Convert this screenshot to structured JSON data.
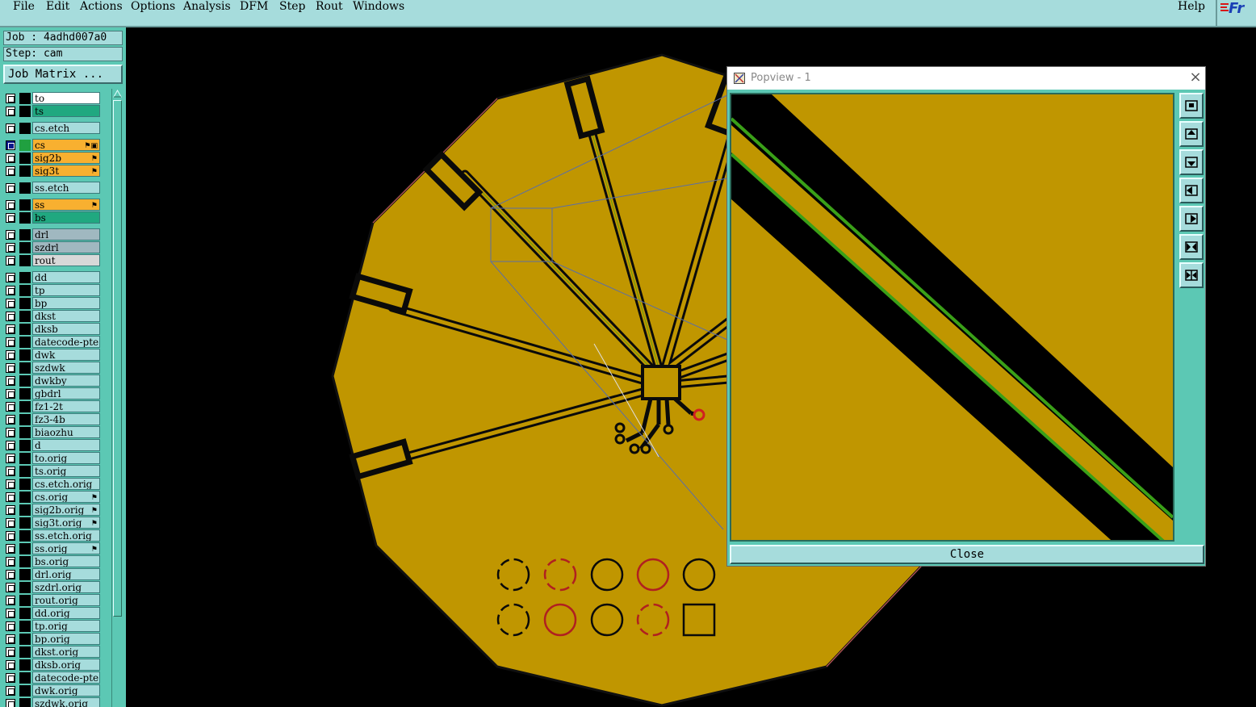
{
  "menu": {
    "items": [
      {
        "label": "File",
        "key": "file"
      },
      {
        "label": "Edit",
        "key": "edit"
      },
      {
        "label": "Actions",
        "key": "actions"
      },
      {
        "label": "Options",
        "key": "options"
      },
      {
        "label": "Analysis",
        "key": "analysis"
      },
      {
        "label": "DFM",
        "key": "dfm"
      },
      {
        "label": "Step",
        "key": "step"
      },
      {
        "label": "Rout",
        "key": "rout"
      },
      {
        "label": "Windows",
        "key": "windows"
      }
    ],
    "help": "Help",
    "logo": "Fr"
  },
  "job": {
    "job_text": "Job : 4adhd007a0",
    "step_text": "Step: cam",
    "matrix_button": "Job Matrix ..."
  },
  "layers": [
    {
      "name": "to",
      "color": "#ffffff",
      "box": "#000000",
      "flag": ""
    },
    {
      "name": "ts",
      "color": "#20a880",
      "box": "#000000",
      "flag": ""
    },
    {
      "name": "cs.etch",
      "color": "#a6dcdc",
      "box": "#000000",
      "flag": ""
    },
    {
      "name": "cs",
      "color": "#f8b030",
      "box": "#20a040",
      "flag": "⚑▣",
      "selected": true
    },
    {
      "name": "sig2b",
      "color": "#f8b030",
      "box": "#000000",
      "flag": "⚑"
    },
    {
      "name": "sig3t",
      "color": "#f8b030",
      "box": "#000000",
      "flag": "⚑"
    },
    {
      "name": "ss.etch",
      "color": "#a6dcdc",
      "box": "#000000",
      "flag": ""
    },
    {
      "name": "ss",
      "color": "#f8b030",
      "box": "#000000",
      "flag": "⚑"
    },
    {
      "name": "bs",
      "color": "#20a880",
      "box": "#000000",
      "flag": ""
    },
    {
      "name": "drl",
      "color": "#a0b8c0",
      "box": "#000000",
      "flag": ""
    },
    {
      "name": "szdrl",
      "color": "#a0b8c0",
      "box": "#000000",
      "flag": ""
    },
    {
      "name": "rout",
      "color": "#d8d8d8",
      "box": "#000000",
      "flag": ""
    },
    {
      "name": "dd",
      "color": "#a6dcdc",
      "box": "#000000",
      "flag": ""
    },
    {
      "name": "tp",
      "color": "#a6dcdc",
      "box": "#000000",
      "flag": ""
    },
    {
      "name": "bp",
      "color": "#a6dcdc",
      "box": "#000000",
      "flag": ""
    },
    {
      "name": "dkst",
      "color": "#a6dcdc",
      "box": "#000000",
      "flag": ""
    },
    {
      "name": "dksb",
      "color": "#a6dcdc",
      "box": "#000000",
      "flag": ""
    },
    {
      "name": "datecode-pte",
      "color": "#a6dcdc",
      "box": "#000000",
      "flag": ""
    },
    {
      "name": "dwk",
      "color": "#a6dcdc",
      "box": "#000000",
      "flag": ""
    },
    {
      "name": "szdwk",
      "color": "#a6dcdc",
      "box": "#000000",
      "flag": ""
    },
    {
      "name": "dwkby",
      "color": "#a6dcdc",
      "box": "#000000",
      "flag": ""
    },
    {
      "name": "gbdrl",
      "color": "#a6dcdc",
      "box": "#000000",
      "flag": ""
    },
    {
      "name": "fz1-2t",
      "color": "#a6dcdc",
      "box": "#000000",
      "flag": ""
    },
    {
      "name": "fz3-4b",
      "color": "#a6dcdc",
      "box": "#000000",
      "flag": ""
    },
    {
      "name": "biaozhu",
      "color": "#a6dcdc",
      "box": "#000000",
      "flag": ""
    },
    {
      "name": "d",
      "color": "#a6dcdc",
      "box": "#000000",
      "flag": ""
    },
    {
      "name": "to.orig",
      "color": "#a6dcdc",
      "box": "#000000",
      "flag": ""
    },
    {
      "name": "ts.orig",
      "color": "#a6dcdc",
      "box": "#000000",
      "flag": ""
    },
    {
      "name": "cs.etch.orig",
      "color": "#a6dcdc",
      "box": "#000000",
      "flag": ""
    },
    {
      "name": "cs.orig",
      "color": "#a6dcdc",
      "box": "#000000",
      "flag": "⚑"
    },
    {
      "name": "sig2b.orig",
      "color": "#a6dcdc",
      "box": "#000000",
      "flag": "⚑"
    },
    {
      "name": "sig3t.orig",
      "color": "#a6dcdc",
      "box": "#000000",
      "flag": "⚑"
    },
    {
      "name": "ss.etch.orig",
      "color": "#a6dcdc",
      "box": "#000000",
      "flag": ""
    },
    {
      "name": "ss.orig",
      "color": "#a6dcdc",
      "box": "#000000",
      "flag": "⚑"
    },
    {
      "name": "bs.orig",
      "color": "#a6dcdc",
      "box": "#000000",
      "flag": ""
    },
    {
      "name": "drl.orig",
      "color": "#a6dcdc",
      "box": "#000000",
      "flag": ""
    },
    {
      "name": "szdrl.orig",
      "color": "#a6dcdc",
      "box": "#000000",
      "flag": ""
    },
    {
      "name": "rout.orig",
      "color": "#a6dcdc",
      "box": "#000000",
      "flag": ""
    },
    {
      "name": "dd.orig",
      "color": "#a6dcdc",
      "box": "#000000",
      "flag": ""
    },
    {
      "name": "tp.orig",
      "color": "#a6dcdc",
      "box": "#000000",
      "flag": ""
    },
    {
      "name": "bp.orig",
      "color": "#a6dcdc",
      "box": "#000000",
      "flag": ""
    },
    {
      "name": "dkst.orig",
      "color": "#a6dcdc",
      "box": "#000000",
      "flag": ""
    },
    {
      "name": "dksb.orig",
      "color": "#a6dcdc",
      "box": "#000000",
      "flag": ""
    },
    {
      "name": "datecode-pte",
      "color": "#a6dcdc",
      "box": "#000000",
      "flag": ""
    },
    {
      "name": "dwk.orig",
      "color": "#a6dcdc",
      "box": "#000000",
      "flag": ""
    },
    {
      "name": "szdwk.orig",
      "color": "#a6dcdc",
      "box": "#000000",
      "flag": ""
    }
  ],
  "popview": {
    "title": "Popview - 1",
    "close_label": "Close",
    "close_x": "×",
    "toolbar_icons": [
      "zoom-window-icon",
      "pan-up-icon",
      "pan-down-icon",
      "pan-left-icon",
      "pan-right-icon",
      "zoom-out-icon",
      "zoom-in-icon"
    ]
  },
  "colors": {
    "copper": "#c09600",
    "background": "#000000",
    "panel": "#5cc8b4",
    "menubar": "#a6dcdc",
    "trace_highlight": "#3aa018"
  }
}
